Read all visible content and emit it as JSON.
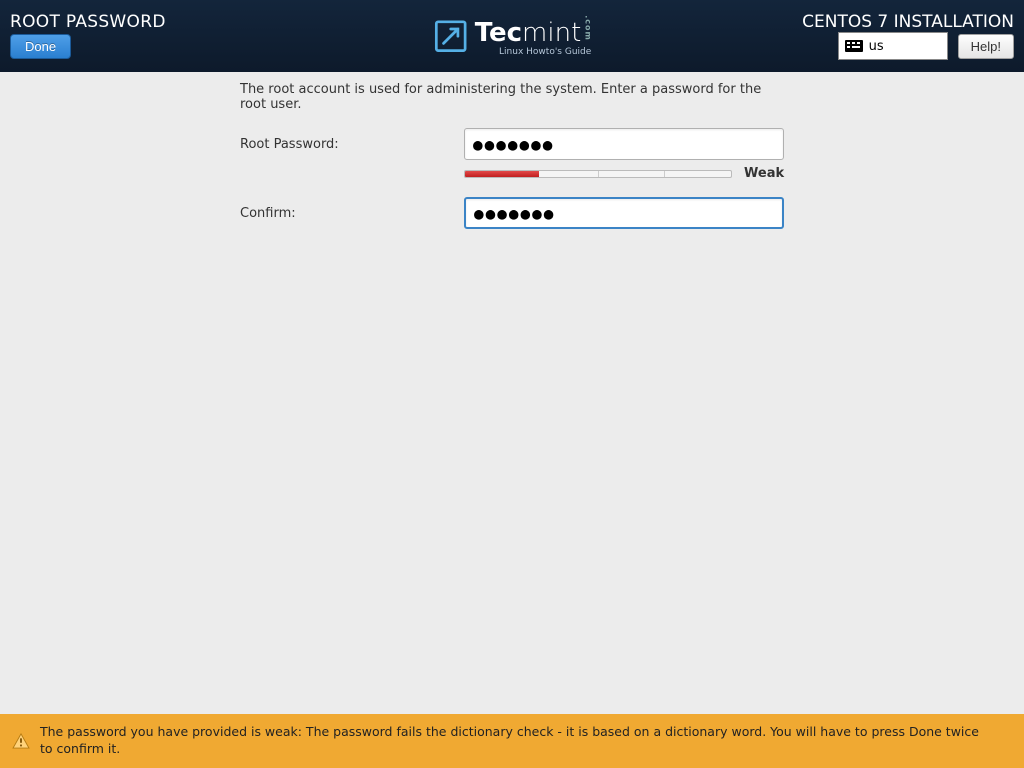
{
  "header": {
    "title": "ROOT PASSWORD",
    "done_label": "Done",
    "right_title": "CENTOS 7 INSTALLATION",
    "keyboard_layout": "us",
    "help_label": "Help!",
    "logo": {
      "brand_left": "Tec",
      "brand_right": "mint",
      "suffix": ".com",
      "tagline": "Linux Howto's Guide"
    }
  },
  "form": {
    "intro": "The root account is used for administering the system.  Enter a password for the root user.",
    "root_password_label": "Root Password:",
    "root_password_value": "●●●●●●●",
    "confirm_label": "Confirm:",
    "confirm_value": "●●●●●●●",
    "strength_label": "Weak",
    "strength_percent": 28
  },
  "footer": {
    "message": "The password you have provided is weak: The password fails the dictionary check - it is based on a dictionary word. You will have to press Done twice to confirm it."
  }
}
